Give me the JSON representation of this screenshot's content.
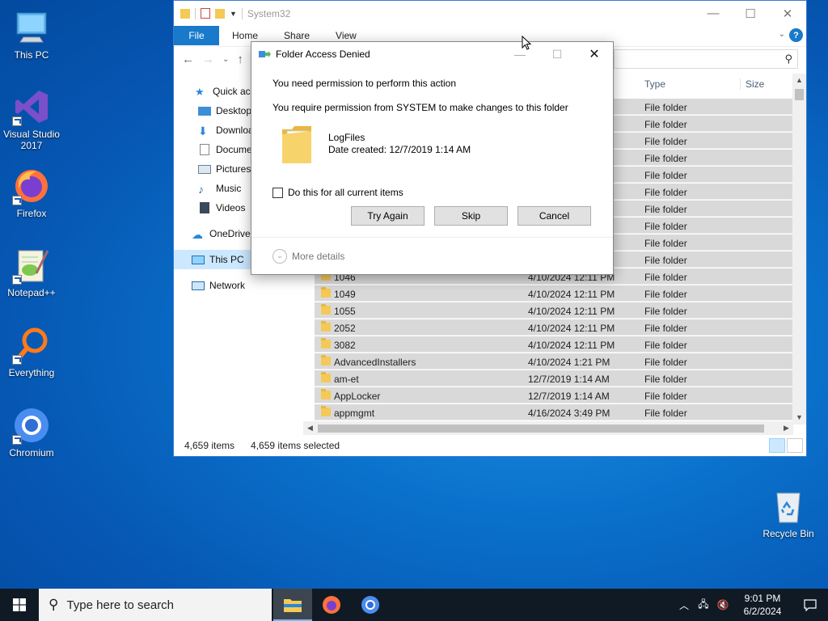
{
  "desktop": {
    "icons": [
      {
        "label": "This PC",
        "icon": "this-pc-icon"
      },
      {
        "label": "Visual Studio 2017",
        "icon": "visual-studio-icon"
      },
      {
        "label": "Firefox",
        "icon": "firefox-icon"
      },
      {
        "label": "Notepad++",
        "icon": "notepadpp-icon"
      },
      {
        "label": "Everything",
        "icon": "everything-icon"
      },
      {
        "label": "Chromium",
        "icon": "chromium-icon"
      },
      {
        "label": "Recycle Bin",
        "icon": "recycle-bin-icon"
      }
    ]
  },
  "explorer": {
    "title": "System32",
    "tabs": {
      "file": "File",
      "home": "Home",
      "share": "Share",
      "view": "View"
    },
    "help": "?",
    "nav": {
      "quick_access": "Quick access",
      "desktop": "Desktop",
      "downloads": "Downloads",
      "documents": "Documents",
      "pictures": "Pictures",
      "music": "Music",
      "videos": "Videos",
      "onedrive": "OneDrive",
      "this_pc": "This PC",
      "network": "Network"
    },
    "columns": {
      "type": "Type",
      "size": "Size"
    },
    "rows": [
      {
        "name": "",
        "date": "",
        "type": "File folder"
      },
      {
        "name": "",
        "date": "",
        "type": "File folder"
      },
      {
        "name": "",
        "date": "",
        "type": "File folder"
      },
      {
        "name": "",
        "date": "",
        "type": "File folder"
      },
      {
        "name": "",
        "date": "",
        "type": "File folder"
      },
      {
        "name": "",
        "date": "",
        "type": "File folder"
      },
      {
        "name": "",
        "date": "",
        "type": "File folder"
      },
      {
        "name": "",
        "date": "",
        "type": "File folder"
      },
      {
        "name": "",
        "date": "",
        "type": "File folder"
      },
      {
        "name": "",
        "date": "",
        "type": "File folder"
      },
      {
        "name": "1046",
        "date": "4/10/2024 12:11 PM",
        "type": "File folder"
      },
      {
        "name": "1049",
        "date": "4/10/2024 12:11 PM",
        "type": "File folder"
      },
      {
        "name": "1055",
        "date": "4/10/2024 12:11 PM",
        "type": "File folder"
      },
      {
        "name": "2052",
        "date": "4/10/2024 12:11 PM",
        "type": "File folder"
      },
      {
        "name": "3082",
        "date": "4/10/2024 12:11 PM",
        "type": "File folder"
      },
      {
        "name": "AdvancedInstallers",
        "date": "4/10/2024 1:21 PM",
        "type": "File folder"
      },
      {
        "name": "am-et",
        "date": "12/7/2019 1:14 AM",
        "type": "File folder"
      },
      {
        "name": "AppLocker",
        "date": "12/7/2019 1:14 AM",
        "type": "File folder"
      },
      {
        "name": "appmgmt",
        "date": "4/16/2024 3:49 PM",
        "type": "File folder"
      }
    ],
    "status": {
      "items": "4,659 items",
      "selected": "4,659 items selected"
    }
  },
  "dialog": {
    "title": "Folder Access Denied",
    "line1": "You need permission to perform this action",
    "line2": "You require permission from SYSTEM to make changes to this folder",
    "folder_name": "LogFiles",
    "folder_date": "Date created: 12/7/2019 1:14 AM",
    "checkbox_label": "Do this for all current items",
    "checkbox_checked": false,
    "buttons": {
      "try_again": "Try Again",
      "skip": "Skip",
      "cancel": "Cancel"
    },
    "more_details": "More details"
  },
  "taskbar": {
    "search_placeholder": "Type here to search",
    "time": "9:01 PM",
    "date": "6/2/2024"
  },
  "colors": {
    "accent": "#1979ca",
    "selection": "#d9d9d9",
    "taskbar": "#101a25"
  }
}
